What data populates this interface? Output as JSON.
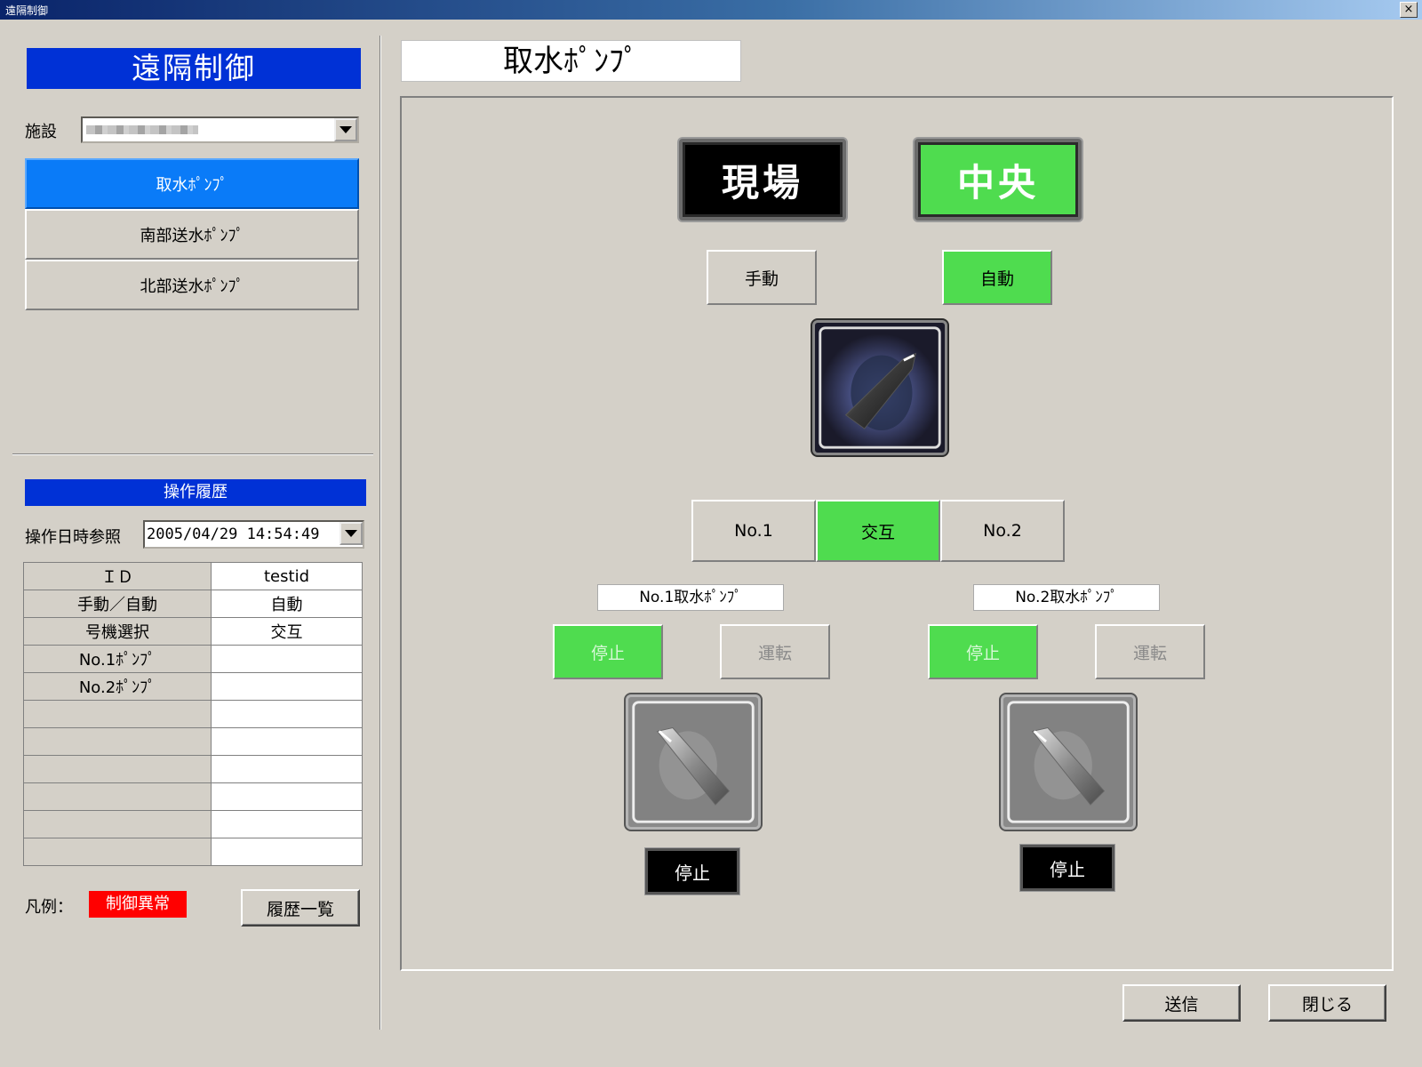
{
  "window": {
    "title": "遠隔制御",
    "close_label": "×"
  },
  "left": {
    "panel_title": "遠隔制御",
    "facility_label": "施設",
    "nav_items": [
      {
        "label": "取水ﾎﾟﾝﾌﾟ",
        "active": true
      },
      {
        "label": "南部送水ﾎﾟﾝﾌﾟ",
        "active": false
      },
      {
        "label": "北部送水ﾎﾟﾝﾌﾟ",
        "active": false
      }
    ],
    "history": {
      "title": "操作履歴",
      "date_label": "操作日時参照",
      "date_value": "2005/04/29 14:54:49",
      "rows": [
        {
          "key": "ＩＤ",
          "value": "testid"
        },
        {
          "key": "手動／自動",
          "value": "自動"
        },
        {
          "key": "号機選択",
          "value": "交互"
        },
        {
          "key": "No.1ﾎﾟﾝﾌﾟ",
          "value": ""
        },
        {
          "key": "No.2ﾎﾟﾝﾌﾟ",
          "value": ""
        },
        {
          "key": "",
          "value": ""
        },
        {
          "key": "",
          "value": ""
        },
        {
          "key": "",
          "value": ""
        },
        {
          "key": "",
          "value": ""
        },
        {
          "key": "",
          "value": ""
        },
        {
          "key": "",
          "value": ""
        }
      ]
    },
    "legend_label": "凡例：",
    "legend_badge": "制御異常",
    "history_list_button": "履歴一覧"
  },
  "main": {
    "page_title": "取水ﾎﾟﾝﾌﾟ",
    "location": {
      "local_label": "現場",
      "central_label": "中央",
      "selected": "central"
    },
    "mode": {
      "manual_label": "手動",
      "auto_label": "自動",
      "selected": "auto"
    },
    "unit_select": {
      "no1_label": "No.1",
      "alternate_label": "交互",
      "no2_label": "No.2",
      "selected": "alternate"
    },
    "pump1": {
      "label": "No.1取水ﾎﾟﾝﾌﾟ",
      "stop_label": "停止",
      "run_label": "運転",
      "status": "停止"
    },
    "pump2": {
      "label": "No.2取水ﾎﾟﾝﾌﾟ",
      "stop_label": "停止",
      "run_label": "運転",
      "status": "停止"
    },
    "send_button": "送信",
    "close_button": "閉じる"
  },
  "colors": {
    "title_blue": "#0031d6",
    "nav_active": "#0a7bf8",
    "active_green": "#4fdc4f",
    "alarm_red": "#ff0000"
  }
}
